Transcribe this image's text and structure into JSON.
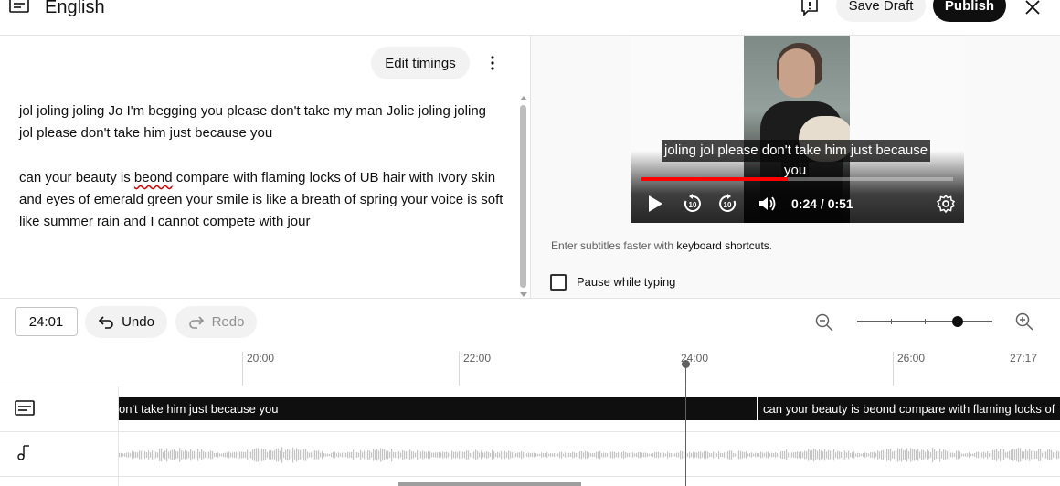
{
  "header": {
    "title": "English",
    "save_draft": "Save Draft",
    "publish": "Publish"
  },
  "editor": {
    "edit_timings": "Edit timings",
    "paragraphs": [
      "jol joling joling Jo I'm begging you please don't take my man Jolie joling joling jol please don't take him just because you",
      "can your beauty is beond compare with flaming locks of UB hair with Ivory skin and eyes of emerald green your smile is like a breath of spring your voice is soft like summer rain and I cannot compete with jour"
    ]
  },
  "player": {
    "caption_line1": "joling jol please don't take him just because",
    "caption_line2": "you",
    "time": "0:24 / 0:51",
    "progress": 0.47,
    "hint_prefix": "Enter subtitles faster with ",
    "hint_link": "keyboard shortcuts",
    "hint_suffix": ".",
    "pause_label": "Pause while typing",
    "pause_checked": false
  },
  "toolbar": {
    "time_value": "24:01",
    "undo": "Undo",
    "redo": "Redo",
    "zoom_level": 0.75
  },
  "timeline": {
    "ticks": [
      "20:00",
      "22:00",
      "24:00",
      "26:00",
      "27:17"
    ],
    "captions": [
      "on't take him just because you",
      "can your beauty is beond compare with  flaming locks of"
    ]
  },
  "colors": {
    "accent_red": "#ff0000",
    "primary": "#0f0f0f",
    "button_bg": "#f2f2f2"
  }
}
